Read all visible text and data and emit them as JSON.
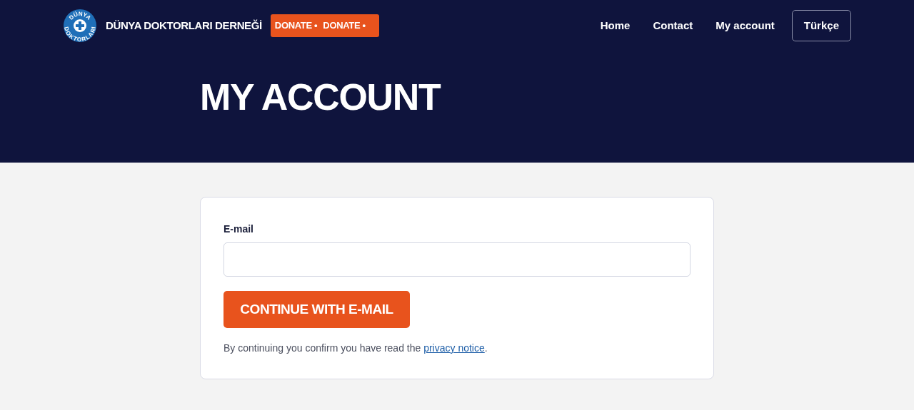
{
  "header": {
    "logo_text": [
      "DÜNYA",
      "DOKTORLARI"
    ],
    "brand": "DÜNYA DOKTORLARI DERNEĞİ",
    "donate": [
      "DONATE •",
      "DONATE •"
    ],
    "nav": [
      {
        "label": "Home"
      },
      {
        "label": "Contact"
      },
      {
        "label": "My account"
      }
    ],
    "language": "Türkçe"
  },
  "hero": {
    "title": "MY ACCOUNT"
  },
  "form": {
    "email_label": "E-mail",
    "button": "CONTINUE WITH E-MAIL",
    "notice": {
      "before": "By continuing you confirm you have read the ",
      "link": "privacy notice",
      "after": "."
    }
  }
}
